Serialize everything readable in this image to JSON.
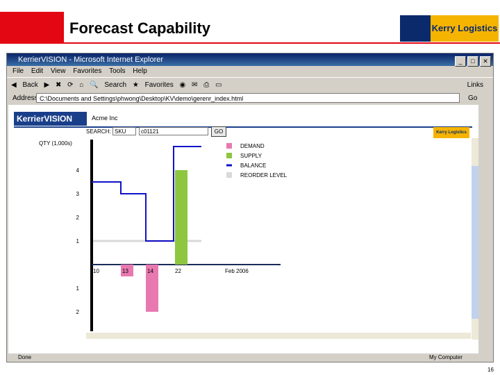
{
  "slide": {
    "title": "Forecast Capability",
    "page_number": "16",
    "logo_text": "Kerry Logistics"
  },
  "browser": {
    "window_title": "KerrierVISION - Microsoft Internet Explorer",
    "menu": [
      "File",
      "Edit",
      "View",
      "Favorites",
      "Tools",
      "Help"
    ],
    "toolbar": {
      "back": "Back",
      "search": "Search",
      "favorites": "Favorites"
    },
    "links_label": "Links",
    "address_label": "Address",
    "address_value": "C:\\Documents and Settings\\phwong\\Desktop\\KV\\demo\\gerenr_index.html",
    "go_label": "Go",
    "status_left": "Done",
    "status_right": "My Computer"
  },
  "app": {
    "brand": "KerrierVISION",
    "company": "Acme Inc",
    "search_label": "SEARCH:",
    "search_field": "SKU",
    "search_value": "c01121",
    "go_label": "GO",
    "kl_logo": "Kerry Logistics"
  },
  "chart_data": {
    "type": "bar",
    "ylabel": "QTY (1,000s)",
    "x_ticks": [
      "10",
      "13",
      "14",
      "22"
    ],
    "x_period_label": "Feb 2006",
    "y_ticks_positive": [
      "1",
      "2",
      "3",
      "4"
    ],
    "y_ticks_negative": [
      "1",
      "2"
    ],
    "legend": [
      {
        "name": "DEMAND",
        "color": "#e879b0"
      },
      {
        "name": "SUPPLY",
        "color": "#8dc63f"
      },
      {
        "name": "BALANCE",
        "color": "#1010c8"
      },
      {
        "name": "REORDER LEVEL",
        "color": "#d9d9d9"
      }
    ],
    "demand": [
      {
        "x": "13",
        "value": -0.5
      },
      {
        "x": "14",
        "value": -2
      }
    ],
    "supply": [
      {
        "x": "22",
        "value": 4
      }
    ],
    "balance": [
      {
        "from": "10",
        "to": "13",
        "value": 3.5
      },
      {
        "from": "13",
        "to": "14",
        "value": 3
      },
      {
        "from": "14",
        "to": "22",
        "value": 1
      },
      {
        "from": "22",
        "to": "end",
        "value": 5
      }
    ],
    "reorder_level": 1
  }
}
